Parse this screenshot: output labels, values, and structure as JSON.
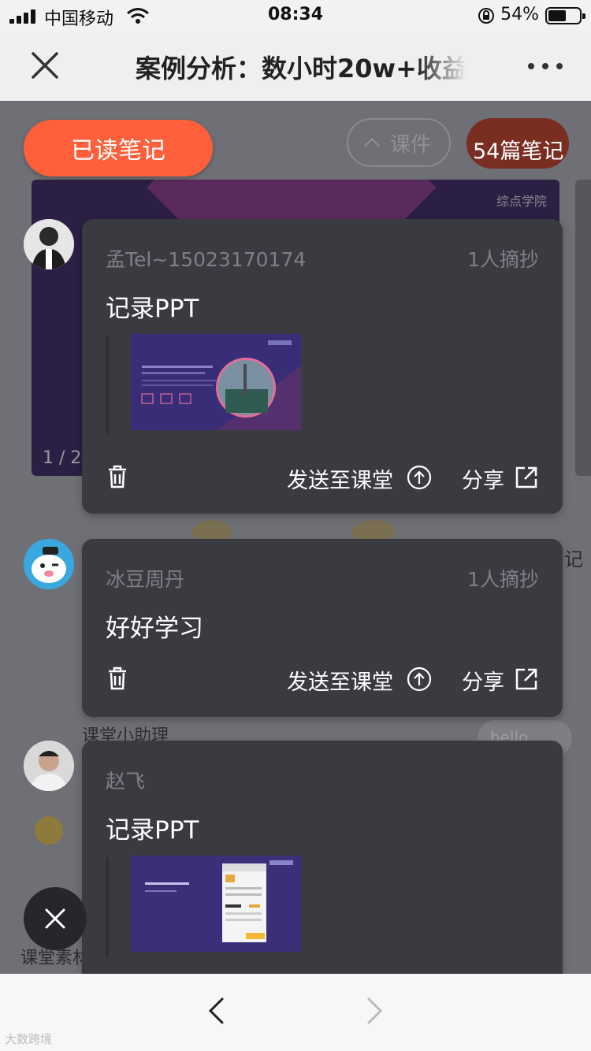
{
  "status_bar": {
    "carrier": "中国移动",
    "time": "08:34",
    "battery": "54%"
  },
  "title_bar": {
    "title": "案例分析：数小时20w+收益"
  },
  "background": {
    "chip_label": "课件",
    "slide_page": "1 / 2",
    "slide_brand": "综点学院",
    "side_text": "记",
    "assistant_text": "课堂小助理",
    "bubble_text": "hello",
    "bottom_text": "课堂素材"
  },
  "read_notes_label": "已读笔记",
  "notes_count": "54篇笔记",
  "notes": [
    {
      "author": "孟Tel~15023170174",
      "excerpts": "1人摘抄",
      "content": "记录PPT",
      "send_label": "发送至课堂",
      "share_label": "分享"
    },
    {
      "author": "冰豆周丹",
      "excerpts": "1人摘抄",
      "content": "好好学习",
      "send_label": "发送至课堂",
      "share_label": "分享"
    },
    {
      "author": "赵飞",
      "excerpts": "",
      "content": "记录PPT"
    }
  ],
  "watermark": "大数跨境",
  "colors": {
    "accent": "#ff5f3a",
    "card_bg": "#3a3b41",
    "overlay_bg": "#6e7075"
  }
}
